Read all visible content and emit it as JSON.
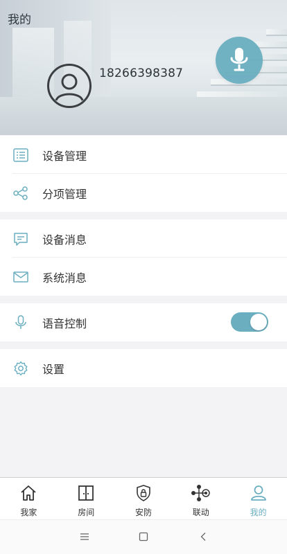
{
  "header": {
    "title": "我的",
    "phone": "18266398387"
  },
  "menu": {
    "group1": [
      {
        "label": "设备管理",
        "icon": "list-icon"
      },
      {
        "label": "分项管理",
        "icon": "nodes-icon"
      }
    ],
    "group2": [
      {
        "label": "设备消息",
        "icon": "message-icon"
      },
      {
        "label": "系统消息",
        "icon": "mail-icon"
      }
    ],
    "voice": {
      "label": "语音控制",
      "icon": "mic-icon",
      "enabled": true
    },
    "settings": {
      "label": "设置",
      "icon": "gear-icon"
    }
  },
  "bottom_nav": [
    {
      "label": "我家",
      "icon": "home-icon",
      "active": false
    },
    {
      "label": "房间",
      "icon": "room-icon",
      "active": false
    },
    {
      "label": "安防",
      "icon": "shield-lock-icon",
      "active": false
    },
    {
      "label": "联动",
      "icon": "link-nodes-icon",
      "active": false
    },
    {
      "label": "我的",
      "icon": "user-icon",
      "active": true
    }
  ],
  "colors": {
    "accent": "#6aaec0",
    "background": "#f3f3f5"
  }
}
